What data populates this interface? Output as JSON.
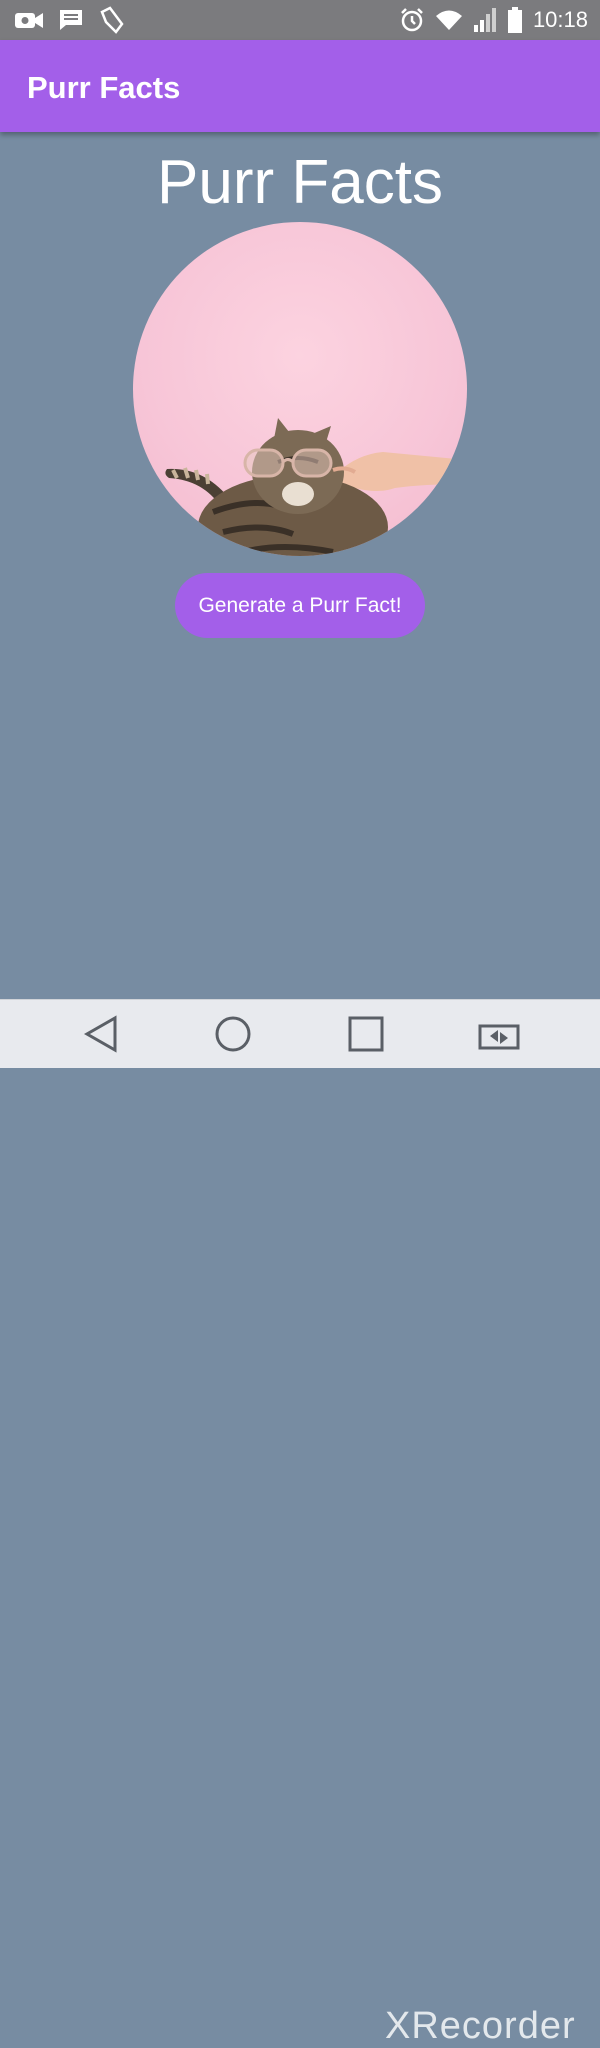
{
  "status_bar": {
    "time": "10:18",
    "left_icons": [
      "video-icon",
      "message-icon",
      "pointer-icon"
    ],
    "right_icons": [
      "alarm-icon",
      "wifi-icon",
      "signal-icon",
      "battery-icon"
    ]
  },
  "app_bar": {
    "title": "Purr Facts",
    "color": "#a35fe9"
  },
  "main": {
    "heading": "Purr Facts",
    "image_alt": "cat wearing glasses",
    "generate_button": "Generate a Purr Fact!"
  },
  "nav_bar": {
    "buttons": [
      "back-icon",
      "home-icon",
      "recents-icon",
      "rotate-icon"
    ]
  },
  "watermark": "XRecorder",
  "colors": {
    "background": "#778ca2",
    "accent": "#a35fe9",
    "status_bar": "#7b7b7e"
  }
}
